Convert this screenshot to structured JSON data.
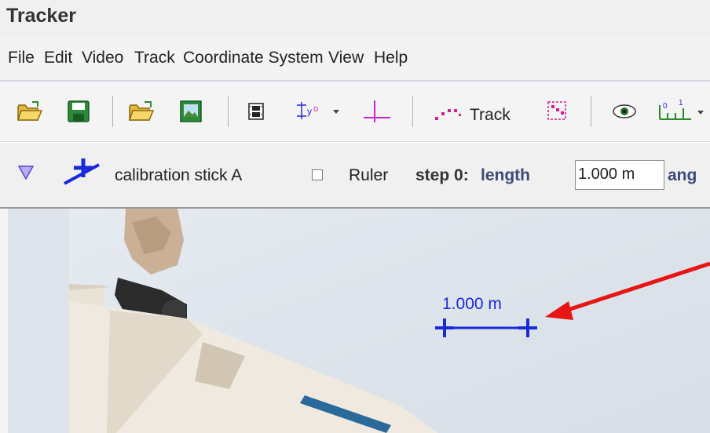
{
  "window": {
    "title": "Tracker"
  },
  "menubar": {
    "items": [
      "File",
      "Edit",
      "Video",
      "Track",
      "Coordinate System",
      "View",
      "Help"
    ]
  },
  "toolbar": {
    "icons": [
      "open-folder-icon",
      "save-icon",
      "open-video-icon",
      "save-image-icon",
      "clip-settings-icon",
      "calibration-tools-icon",
      "axes-icon",
      "track-icon",
      "track-control-icon",
      "visibility-icon",
      "ruler-icon"
    ],
    "track_label": "Track"
  },
  "trackbar": {
    "track_name": "calibration stick A",
    "ruler_label": "Ruler",
    "step_label": "step 0:",
    "length_label": "length",
    "length_value": "1.000 m",
    "angle_label": "ang"
  },
  "video": {
    "scale_label": "1.000 m"
  },
  "colors": {
    "calibration_stick": "#1a2ad8",
    "annotation_arrow": "#e81515",
    "track_magenta": "#d0208a",
    "axes_magenta": "#cc22cc"
  }
}
